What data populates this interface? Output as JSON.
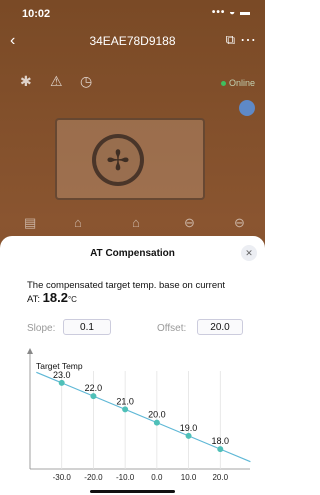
{
  "status": {
    "time": "10:02",
    "signal": "••• ◒ ▬"
  },
  "nav": {
    "back_icon": "‹",
    "title": "34EAE78D9188",
    "share_icon": "⧉",
    "more_icon": "⋯"
  },
  "device": {
    "online_label": "Online"
  },
  "sheet": {
    "title": "AT Compensation",
    "close_icon": "✕",
    "description": "The compensated target temp. base on current",
    "at_label": "AT:",
    "at_value": "18.2",
    "at_unit": "°C",
    "slope_label": "Slope:",
    "slope_value": "0.1",
    "offset_label": "Offset:",
    "offset_value": "20.0"
  },
  "chart_data": {
    "type": "line",
    "ylabel": "Target Temp",
    "x": [
      -30.0,
      -20.0,
      -10.0,
      0.0,
      10.0,
      20.0
    ],
    "x_tick_labels": [
      "-30.0",
      "-20.0",
      "-10.0",
      "0.0",
      "10.0",
      "20.0"
    ],
    "values": [
      23.0,
      22.0,
      21.0,
      20.0,
      19.0,
      18.0
    ],
    "point_labels": [
      "23.0",
      "22.0",
      "21.0",
      "20.0",
      "19.0",
      "18.0"
    ],
    "x_range": [
      -40,
      30
    ],
    "y_range": [
      16.5,
      24.5
    ],
    "line_color": "#5fb8d6",
    "point_color": "#4fc0b8",
    "grid": "vertical"
  }
}
